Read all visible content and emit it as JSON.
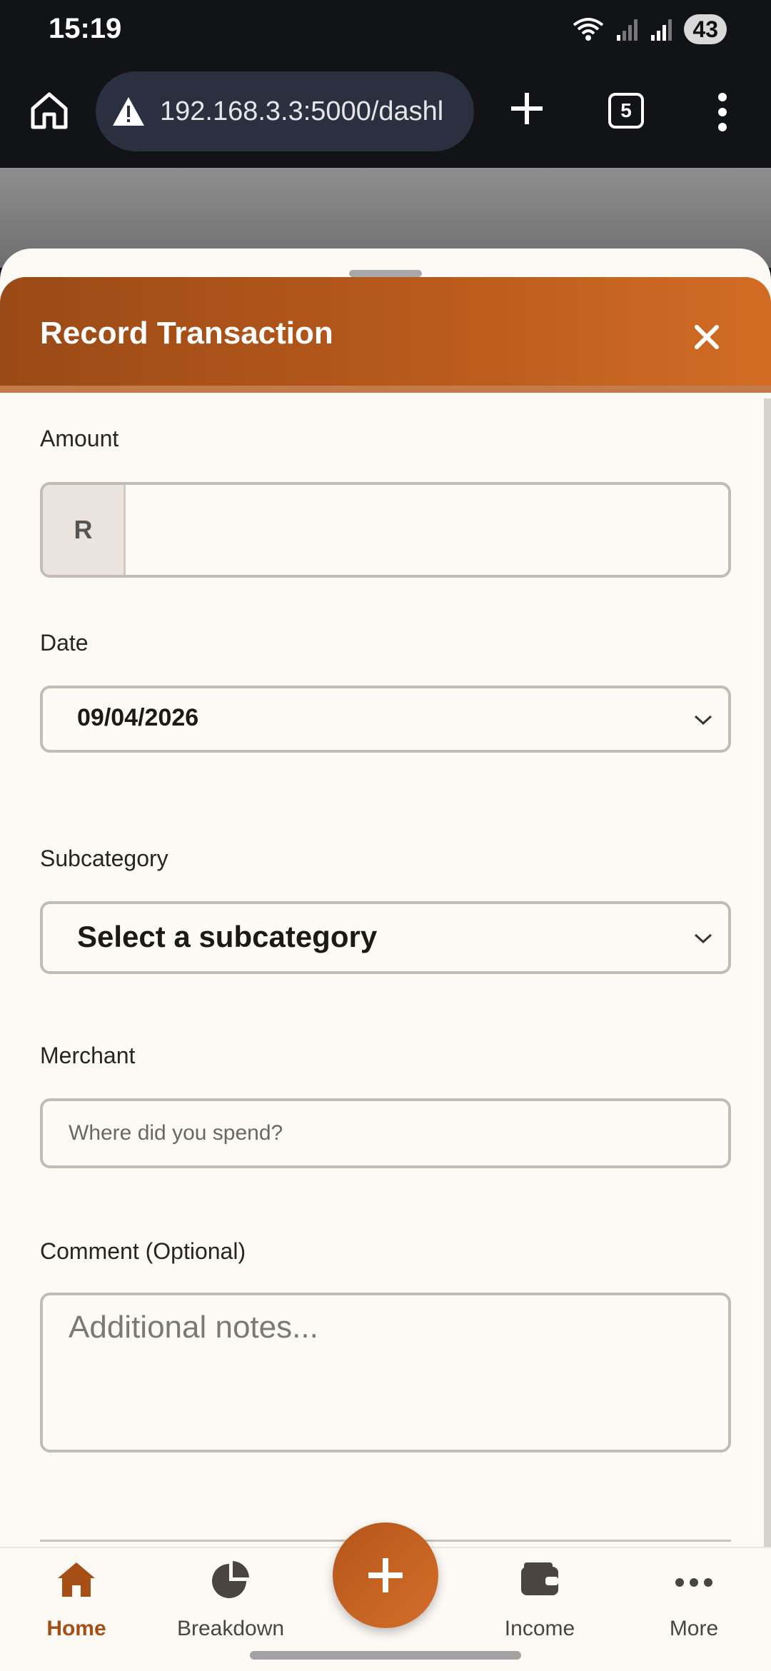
{
  "status_bar": {
    "time": "15:19",
    "battery": "43"
  },
  "browser": {
    "url": "192.168.3.3:5000/dashl",
    "tab_count": "5"
  },
  "sheet": {
    "title": "Record Transaction"
  },
  "form": {
    "amount": {
      "label": "Amount",
      "prefix": "R",
      "value": ""
    },
    "date": {
      "label": "Date",
      "value": "09/04/2026"
    },
    "subcategory": {
      "label": "Subcategory",
      "selected": "Select a subcategory"
    },
    "merchant": {
      "label": "Merchant",
      "placeholder": "Where did you spend?"
    },
    "comment": {
      "label": "Comment (Optional)",
      "placeholder": "Additional notes..."
    }
  },
  "nav": {
    "items": [
      {
        "label": "Home",
        "icon": "home-icon",
        "active": true
      },
      {
        "label": "Breakdown",
        "icon": "pie-chart-icon",
        "active": false
      },
      {
        "label": "Income",
        "icon": "wallet-icon",
        "active": false
      },
      {
        "label": "More",
        "icon": "more-dots-icon",
        "active": false
      }
    ],
    "fab_icon": "plus-icon"
  },
  "colors": {
    "accent": "#b4551a",
    "active_nav": "#a54f17",
    "sheet_bg": "#fdfaf6"
  }
}
